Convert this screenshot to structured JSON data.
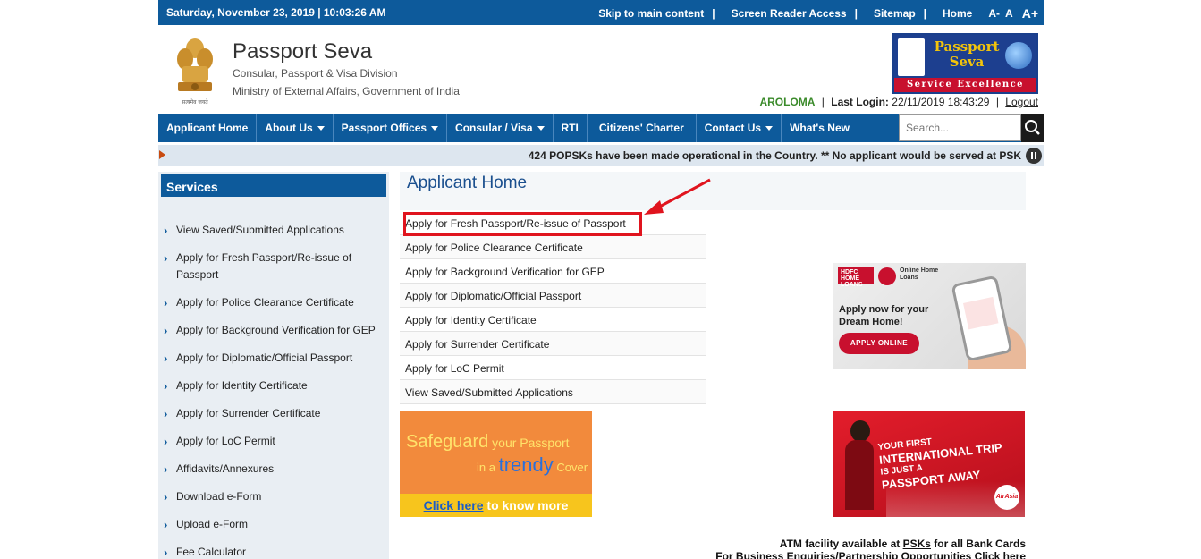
{
  "topbar": {
    "date": "Saturday,  November  23, 2019 | 10:03:26 AM",
    "skip": "Skip to main content",
    "screen_reader": "Screen Reader Access",
    "sitemap": "Sitemap",
    "home": "Home",
    "font_small": "A-",
    "font_normal": "A",
    "font_large": "A+",
    "sep": "|"
  },
  "header": {
    "title": "Passport Seva",
    "sub1": "Consular, Passport & Visa Division",
    "sub2": "Ministry of External Affairs, Government of India",
    "emblem_caption": "सत्यमेव जयते",
    "logo_line1": "Passport",
    "logo_line2": "Seva",
    "logo_band": "Service Excellence"
  },
  "user": {
    "name": "AROLOMA",
    "sep": "|",
    "last_login_label": "Last Login:",
    "last_login_value": "22/11/2019 18:43:29",
    "logout": "Logout"
  },
  "nav": {
    "items": [
      {
        "label": "Applicant Home",
        "dropdown": false
      },
      {
        "label": "About Us",
        "dropdown": true
      },
      {
        "label": "Passport Offices",
        "dropdown": true
      },
      {
        "label": "Consular / Visa",
        "dropdown": true
      },
      {
        "label": "RTI",
        "dropdown": false
      },
      {
        "label": "Citizens' Charter",
        "dropdown": false
      },
      {
        "label": "Contact Us",
        "dropdown": true
      },
      {
        "label": "What's New",
        "dropdown": false
      }
    ],
    "search_placeholder": "Search..."
  },
  "ticker": {
    "message": "424 POPSKs have been made operational in the Country. ** No applicant would be served at PSK"
  },
  "sidebar": {
    "heading": "Services",
    "items": [
      "View Saved/Submitted Applications",
      "Apply for Fresh Passport/Re-issue of Passport",
      "Apply for Police Clearance Certificate",
      "Apply for Background Verification for GEP",
      "Apply for Diplomatic/Official Passport",
      "Apply for Identity Certificate",
      "Apply for Surrender Certificate",
      "Apply for LoC Permit",
      "Affidavits/Annexures",
      "Download e-Form",
      "Upload e-Form",
      "Fee Calculator"
    ]
  },
  "main": {
    "title": "Applicant Home",
    "services": [
      "Apply for Fresh Passport/Re-issue of Passport",
      "Apply for Police Clearance Certificate",
      "Apply for Background Verification for GEP",
      "Apply for Diplomatic/Official Passport",
      "Apply for Identity Certificate",
      "Apply for Surrender Certificate",
      "Apply for LoC Permit",
      "View Saved/Submitted Applications"
    ],
    "highlight_color": "#e0141e"
  },
  "ads": {
    "hdfc": {
      "logo": "HDFC HOME LOANS",
      "online": "Online Home Loans",
      "message": "Apply now for your Dream Home!",
      "button": "APPLY ONLINE"
    },
    "cover": {
      "line1_a": "Safeguard",
      "line1_b": " your Passport",
      "line2_a": "in a ",
      "line2_b": "trendy",
      "line2_c": " Cover",
      "cta_link": "Click here",
      "cta_rest": " to know more"
    },
    "airasia": {
      "l1": "YOUR FIRST",
      "l2": "INTERNATIONAL TRIP",
      "l3": "IS JUST A",
      "l4": "PASSPORT AWAY",
      "logo": "AirAsia"
    }
  },
  "footer": {
    "atm_prefix": "ATM facility available at ",
    "atm_link": "PSKs",
    "atm_suffix": " for all Bank Cards",
    "business": "For Business Enquiries/Partnership Opportunities Click here"
  },
  "colors": {
    "primary": "#0d5a9b",
    "accent_red": "#e0141e",
    "username_green": "#3a8a2a"
  }
}
